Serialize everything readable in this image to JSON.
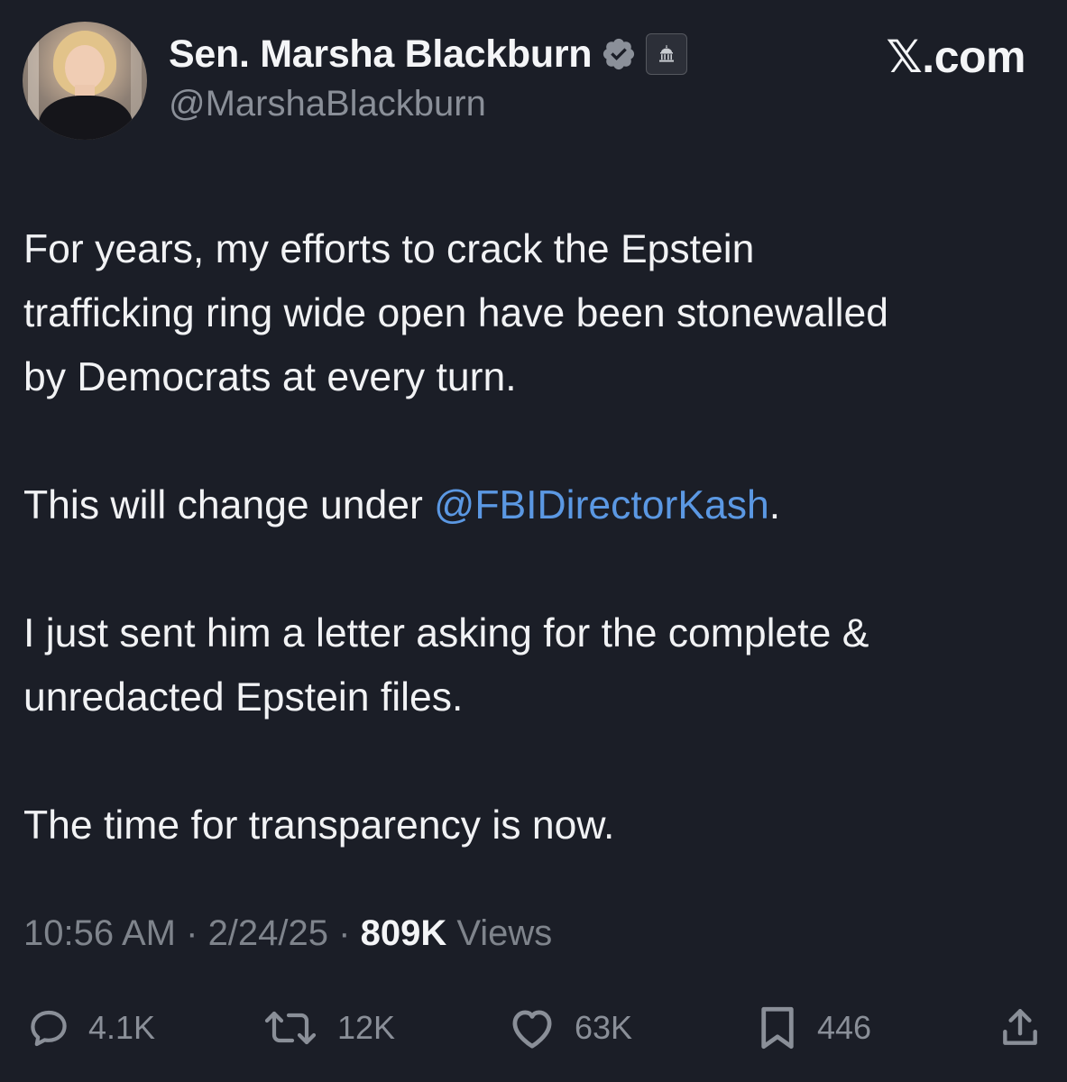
{
  "author": {
    "name": "Sen. Marsha Blackburn",
    "handle": "@MarshaBlackburn",
    "verified_icon": "verified-badge-icon",
    "affiliation_icon": "government-building-icon"
  },
  "site_label": "𝕏.com",
  "tweet": {
    "paragraph1": "For years, my efforts to crack the Epstein trafficking ring wide open have been stonewalled by Democrats at every turn.",
    "paragraph2_before": "This will change under ",
    "paragraph2_mention": "@FBIDirectorKash",
    "paragraph2_after": ".",
    "paragraph3": "I just sent him a letter asking for the complete & unredacted Epstein files.",
    "paragraph4": "The time for transparency is now."
  },
  "meta": {
    "time": "10:56 AM",
    "separator": " · ",
    "date": "2/24/25",
    "views_count": "809K",
    "views_label": " Views"
  },
  "actions": {
    "replies": "4.1K",
    "reposts": "12K",
    "likes": "63K",
    "bookmarks": "446"
  },
  "colors": {
    "background": "#1b1e27",
    "mention": "#5b98e3",
    "muted": "#7f848c"
  }
}
